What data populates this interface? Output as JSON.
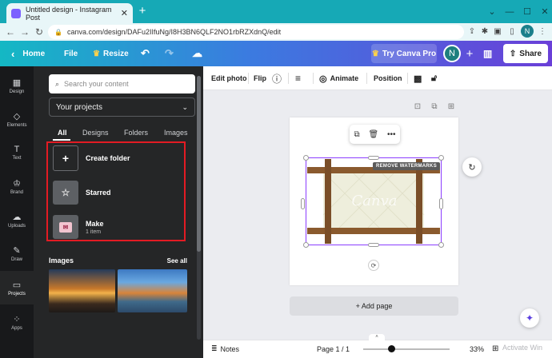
{
  "browser": {
    "tab_title": "Untitled design - Instagram Post",
    "tab_close": "✕",
    "new_tab": "+",
    "url": "canva.com/design/DAFu2IIfuNg/I8H3BN6QLF2NO1rbRZXdnQ/edit",
    "profile_initial": "N"
  },
  "topbar": {
    "home": "Home",
    "file": "File",
    "resize": "Resize",
    "try_pro": "Try Canva Pro",
    "avatar_initial": "N",
    "share": "Share"
  },
  "rail": [
    {
      "label": "Design",
      "icon": "design-icon"
    },
    {
      "label": "Elements",
      "icon": "elements-icon"
    },
    {
      "label": "Text",
      "icon": "text-icon"
    },
    {
      "label": "Brand",
      "icon": "brand-icon"
    },
    {
      "label": "Uploads",
      "icon": "uploads-icon"
    },
    {
      "label": "Draw",
      "icon": "draw-icon"
    },
    {
      "label": "Projects",
      "icon": "projects-icon"
    },
    {
      "label": "Apps",
      "icon": "apps-icon"
    }
  ],
  "panel": {
    "search_placeholder": "Search your content",
    "select_value": "Your projects",
    "tabs": [
      "All",
      "Designs",
      "Folders",
      "Images"
    ],
    "create_folder": "Create folder",
    "starred": "Starred",
    "make": "Make",
    "make_count": "1 item",
    "images_heading": "Images",
    "see_all": "See all"
  },
  "context_toolbar": {
    "edit_photo": "Edit photo",
    "flip": "Flip",
    "animate": "Animate",
    "position": "Position"
  },
  "canvas": {
    "remove_watermarks": "REMOVE WATERMARKS",
    "watermark_text": "Canva",
    "add_page": "+ Add page"
  },
  "footer": {
    "notes": "Notes",
    "page_indicator": "Page 1 / 1",
    "zoom": "33%",
    "zoom_fraction": 0.33,
    "activate_text": "Activate Win"
  },
  "colors": {
    "topbar_start": "#14b8c4",
    "topbar_end": "#6a3fd8",
    "selection": "#8b3dff",
    "highlight": "#e31b23"
  }
}
